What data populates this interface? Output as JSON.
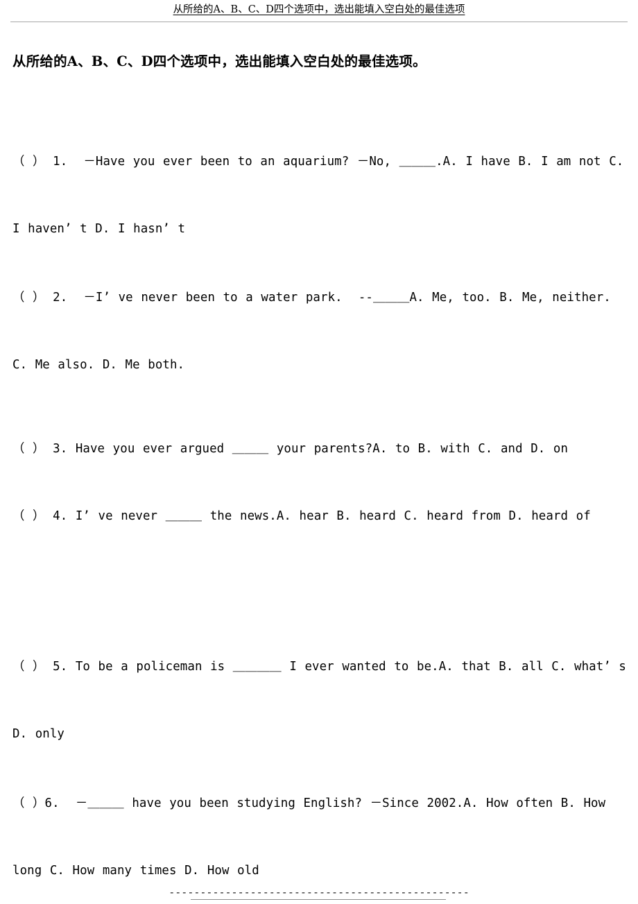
{
  "header": {
    "title": "从所给的A、B、C、D四个选项中，选出能填入空白处的最佳选项"
  },
  "intro": {
    "text": "从所给的A、B、C、D四个选项中，选出能填入空白处的最佳选项。"
  },
  "questions": [
    {
      "id": "q1",
      "text": "（ ） 1.  －Have you ever been to an aquarium? －No, ＿＿＿.A. I have B. I am not C. I haven’ t D. I hasn’ t"
    },
    {
      "id": "q2",
      "text": "（ ） 2.  －I’ ve never been to a water park.  --＿＿＿A. Me, too. B. Me, neither. C. Me also. D. Me both."
    },
    {
      "id": "q3",
      "text": "（ ） 3. Have you ever argued ＿＿＿ your parents?A. to B. with C. and D. on"
    },
    {
      "id": "q4",
      "text": "（ ） 4. I’ ve never ＿＿＿ the news.A. hear B. heard C. heard from D. heard of"
    },
    {
      "id": "q5",
      "text": "（ ） 5. To be a policeman is ＿＿＿＿ I ever wanted to be.A. that B. all C. what’ s D. only"
    },
    {
      "id": "q6",
      "text": "（ ）6.  －＿＿＿ have you been studying English? －Since 2002.A. How often B. How long C. How many times D. How old"
    }
  ],
  "footer": {
    "separator": "------------------------------------------------"
  },
  "colors": {
    "text": "#000000",
    "rule": "#a8a8a8",
    "footer_rule": "#8c8c8c",
    "background": "#ffffff"
  }
}
